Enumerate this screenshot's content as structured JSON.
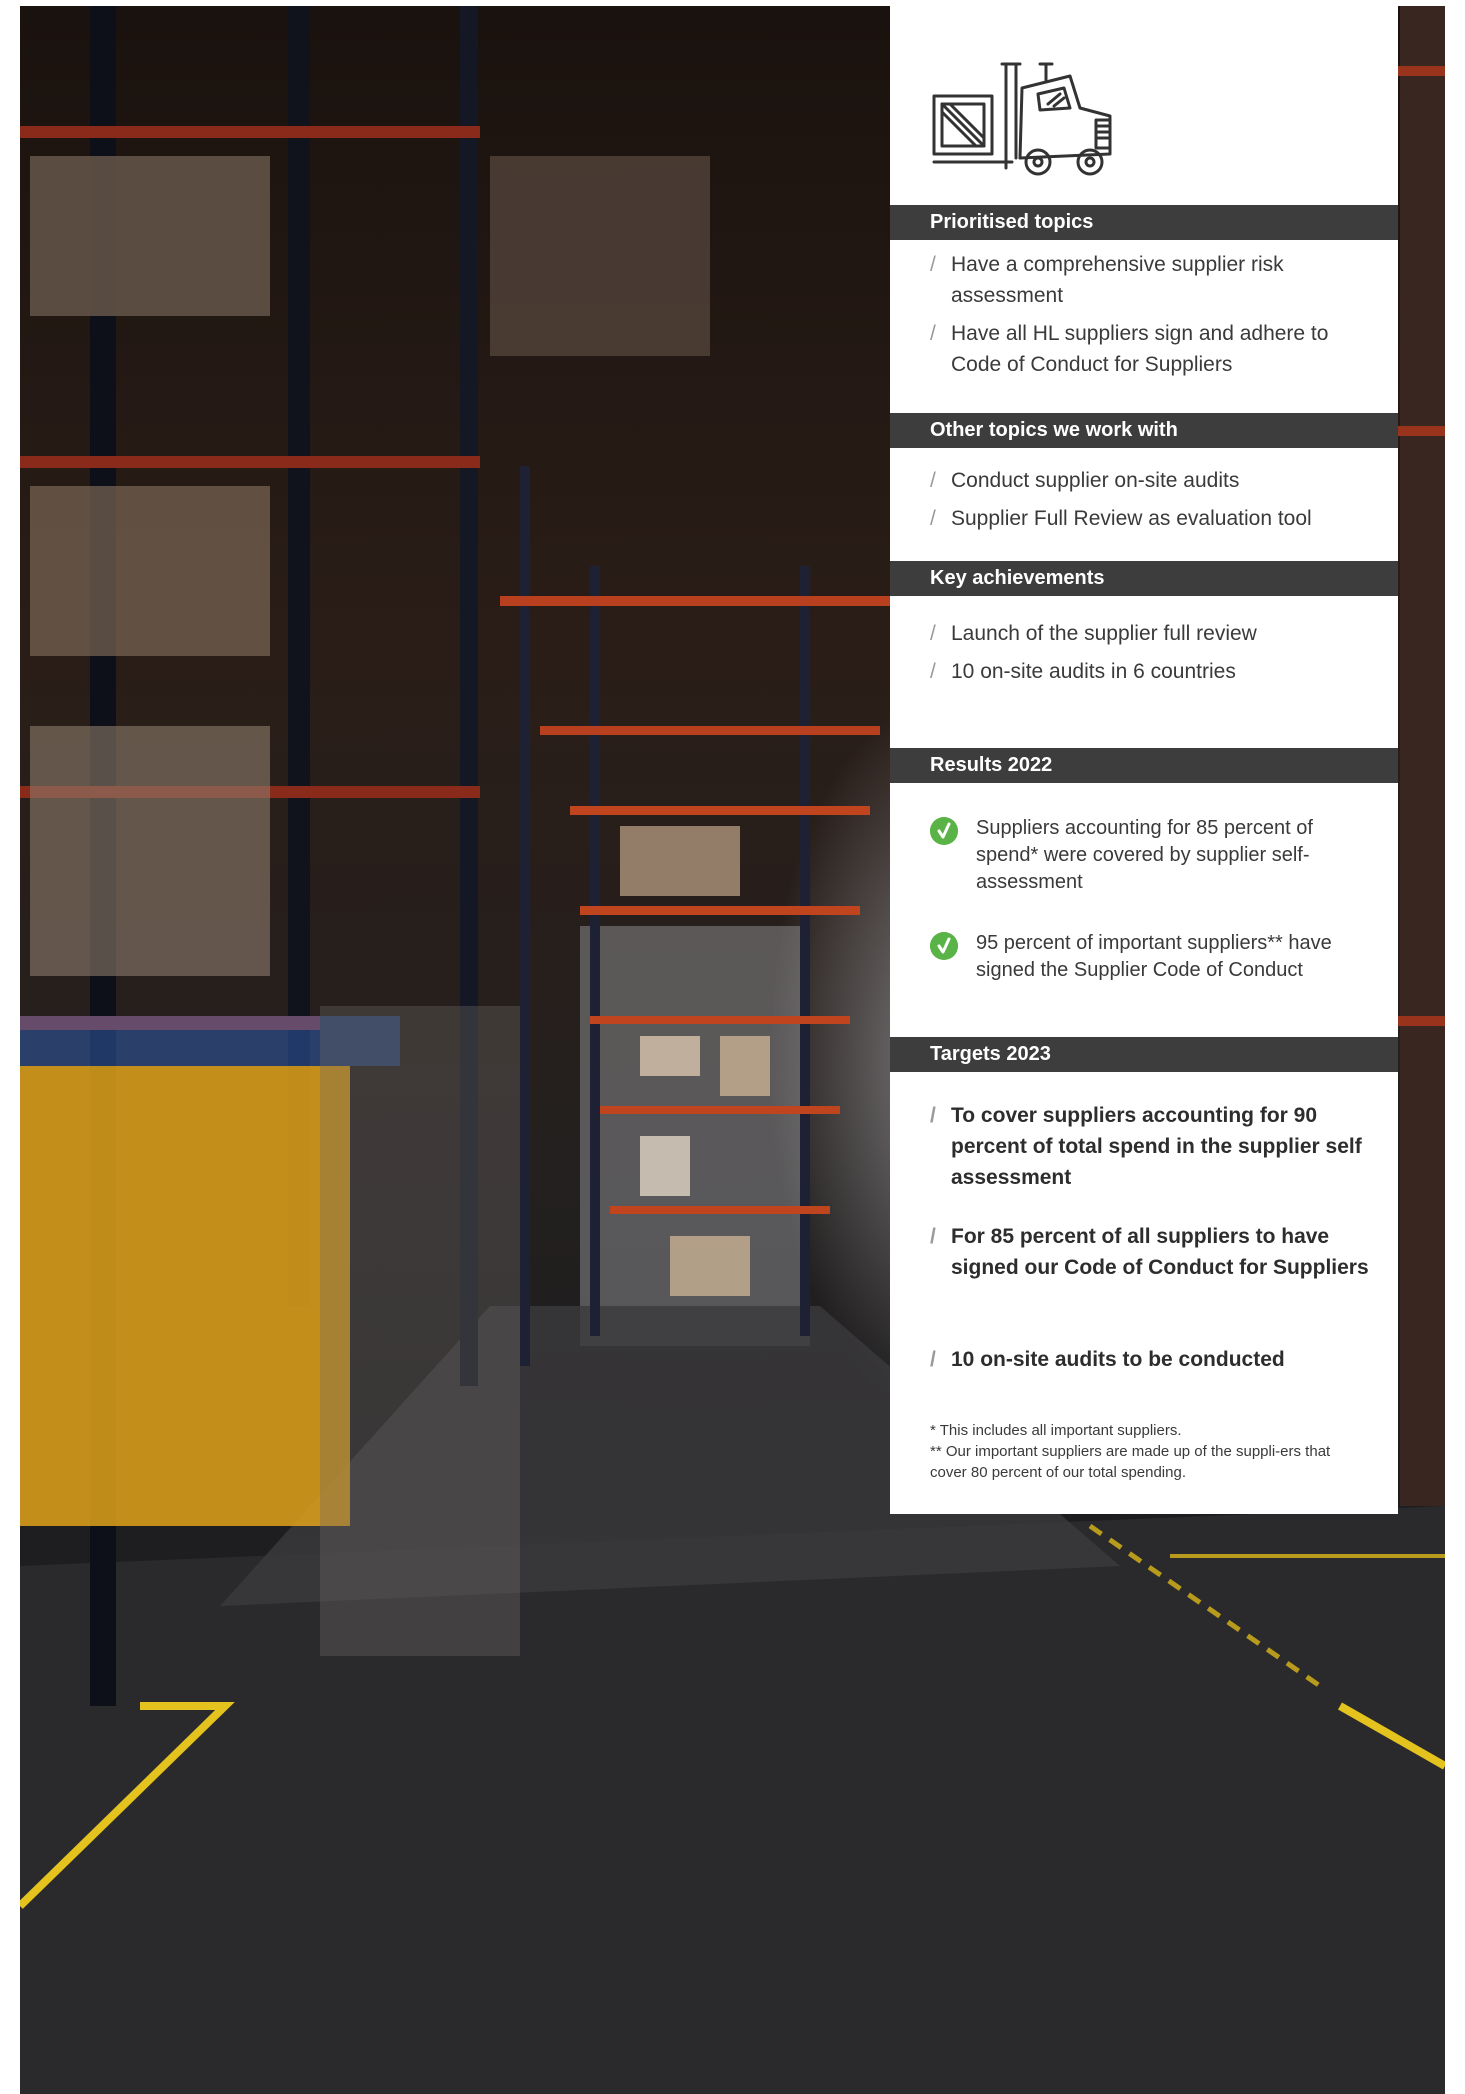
{
  "sections": {
    "prioritised": {
      "title": "Prioritised topics",
      "items": [
        "Have a comprehensive supplier risk assessment",
        "Have all HL suppliers sign and adhere to Code of Conduct for Suppliers"
      ]
    },
    "other": {
      "title": "Other topics we work with",
      "items": [
        "Conduct supplier on-site audits",
        "Supplier Full Review as evaluation tool"
      ]
    },
    "achievements": {
      "title": "Key achievements",
      "items": [
        "Launch of the supplier full review",
        "10 on-site audits in 6 countries"
      ]
    },
    "results": {
      "title": "Results 2022",
      "items": [
        "Suppliers accounting for 85 percent of spend* were covered by supplier self-assessment",
        "95 percent of important suppliers** have signed the Supplier Code of Conduct"
      ]
    },
    "targets": {
      "title": "Targets 2023",
      "items": [
        "To cover suppliers accounting for 90 percent of total spend in the supplier self assessment",
        "For 85 percent of all suppliers to have signed our Code of Conduct for Suppliers",
        "10 on-site audits to be conducted"
      ]
    }
  },
  "slash_glyph": "/",
  "footnotes": [
    "* This includes all important suppliers.",
    "** Our important suppliers are made up of the suppli-ers that cover 80 percent of our total spending."
  ],
  "icons": {
    "header_illustration": "forklift-icon",
    "result_marker": "checkmark-circle-icon"
  },
  "colors": {
    "section_header_bg": "#3d3d3d",
    "check_green": "#5ab347",
    "slash_grey": "#9a9a9a"
  }
}
